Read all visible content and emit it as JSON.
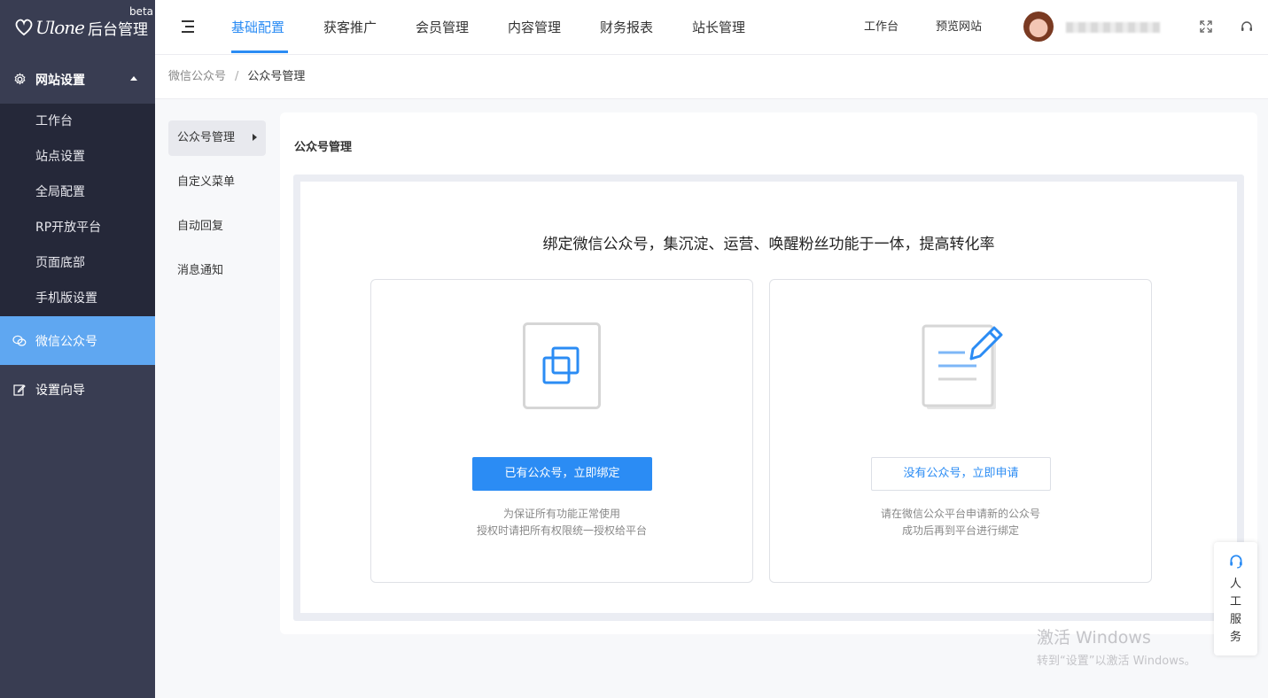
{
  "sidebar": {
    "logo_script": "Ulone",
    "logo_title": "后台管理",
    "logo_badge": "beta",
    "group_website": "网站设置",
    "items": [
      "工作台",
      "站点设置",
      "全局配置",
      "RP开放平台",
      "页面底部",
      "手机版设置"
    ],
    "active_group": "微信公众号",
    "wizard": "设置向导"
  },
  "topbar": {
    "tabs": [
      "基础配置",
      "获客推广",
      "会员管理",
      "内容管理",
      "财务报表",
      "站长管理"
    ],
    "active_tab": "基础配置",
    "workbench_link": "工作台",
    "preview_link": "预览网站"
  },
  "breadcrumb": {
    "parent": "微信公众号",
    "separator": "/",
    "current": "公众号管理"
  },
  "subnav": {
    "items": [
      "公众号管理",
      "自定义菜单",
      "自动回复",
      "消息通知"
    ],
    "active": "公众号管理"
  },
  "card": {
    "title": "公众号管理",
    "headline": "绑定微信公众号，集沉淀、运营、唤醒粉丝功能于一体，提高转化率",
    "bind_option": {
      "button": "已有公众号，立即绑定",
      "hint_line1": "为保证所有功能正常使用",
      "hint_line2": "授权时请把所有权限统一授权给平台"
    },
    "apply_option": {
      "button": "没有公众号，立即申请",
      "hint_line1": "请在微信公众平台申请新的公众号",
      "hint_line2": "成功后再到平台进行绑定"
    }
  },
  "float_service": {
    "label": [
      "人",
      "工",
      "服",
      "务"
    ]
  },
  "watermark": {
    "line1": "激活 Windows",
    "line2": "转到“设置”以激活 Windows。"
  },
  "colors": {
    "accent": "#2b8cf4",
    "sidebar_bg": "#393d52",
    "sidebar_sub_bg": "#252839",
    "sidebar_active": "#5fa7f1"
  }
}
